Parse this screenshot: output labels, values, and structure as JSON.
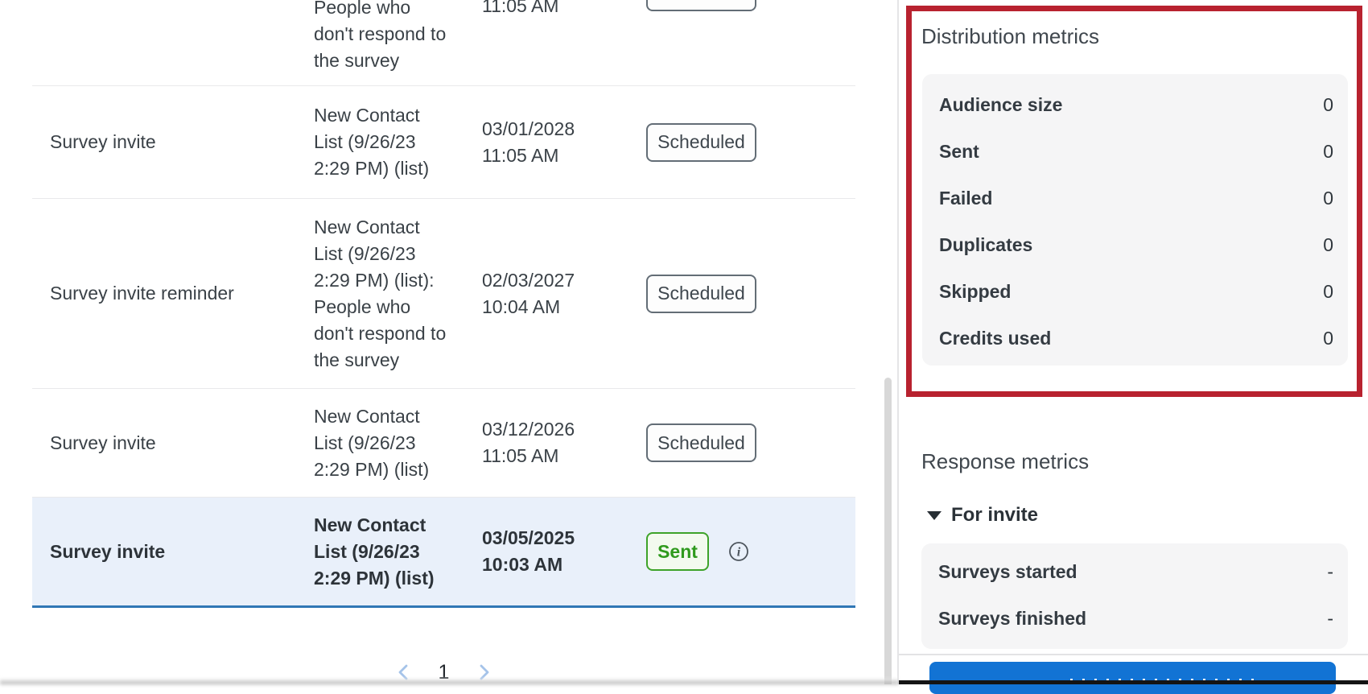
{
  "colors": {
    "annotation_red": "#b8222f",
    "primary_blue": "#1273d4",
    "sent_green": "#2f9a1d",
    "highlight_row_blue": "#e9f0fa"
  },
  "table": {
    "rows": [
      {
        "type": "",
        "audience": "People who\ndon't respond to\nthe survey",
        "datetime": "11:05 AM",
        "status": ""
      },
      {
        "type": "Survey invite",
        "audience": "New Contact\nList (9/26/23\n2:29 PM) (list)",
        "datetime": "03/01/2028\n11:05 AM",
        "status": "Scheduled"
      },
      {
        "type": "Survey invite reminder",
        "audience": "New Contact\nList (9/26/23\n2:29 PM) (list):\nPeople who\ndon't respond to\nthe survey",
        "datetime": "02/03/2027\n10:04 AM",
        "status": "Scheduled"
      },
      {
        "type": "Survey invite",
        "audience": "New Contact\nList (9/26/23\n2:29 PM) (list)",
        "datetime": "03/12/2026\n11:05 AM",
        "status": "Scheduled"
      },
      {
        "type": "Survey invite",
        "audience": "New Contact\nList (9/26/23\n2:29 PM) (list)",
        "datetime": "03/05/2025\n10:03 AM",
        "status": "Sent"
      }
    ],
    "pagination": {
      "current_page": "1"
    }
  },
  "side_panel": {
    "distribution_metrics": {
      "title": "Distribution metrics",
      "rows": [
        {
          "label": "Audience size",
          "value": "0"
        },
        {
          "label": "Sent",
          "value": "0"
        },
        {
          "label": "Failed",
          "value": "0"
        },
        {
          "label": "Duplicates",
          "value": "0"
        },
        {
          "label": "Skipped",
          "value": "0"
        },
        {
          "label": "Credits used",
          "value": "0"
        }
      ]
    },
    "response_metrics": {
      "title": "Response metrics",
      "group_label": "For invite",
      "rows": [
        {
          "label": "Surveys started",
          "value": "-"
        },
        {
          "label": "Surveys finished",
          "value": "-"
        }
      ]
    }
  }
}
